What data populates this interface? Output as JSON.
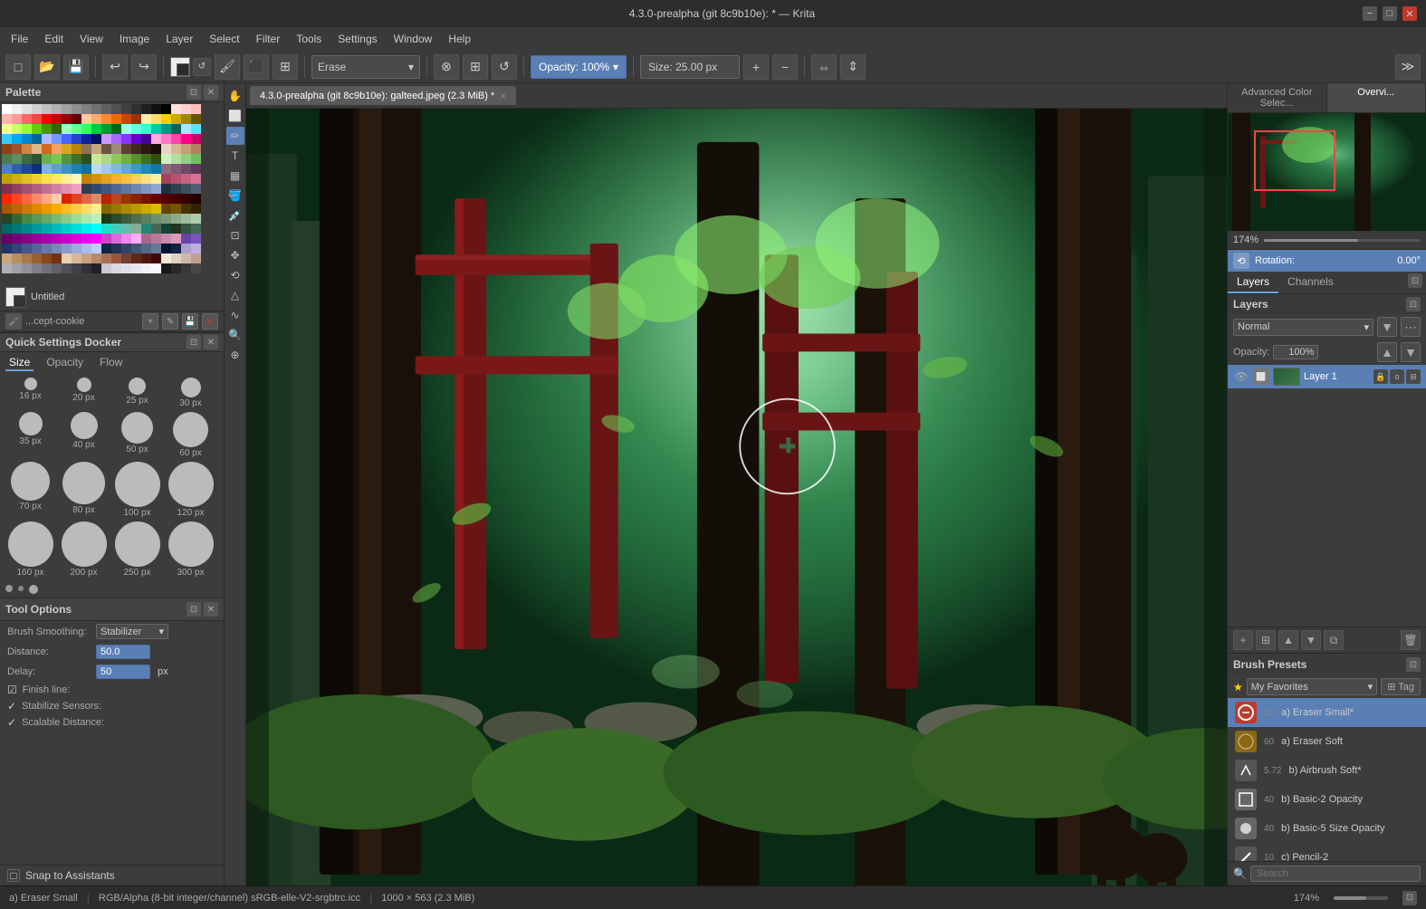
{
  "window": {
    "title": "4.3.0-prealpha (git 8c9b10e):  * — Krita",
    "min_btn": "−",
    "restore_btn": "□",
    "close_btn": "✕"
  },
  "menu": {
    "items": [
      "File",
      "Edit",
      "View",
      "Image",
      "Layer",
      "Select",
      "Filter",
      "Tools",
      "Settings",
      "Window",
      "Help"
    ]
  },
  "toolbar": {
    "erase_label": "Erase",
    "opacity_label": "Opacity: 100%",
    "size_label": "Size: 25.00 px"
  },
  "canvas_tab": {
    "label": "4.3.0-prealpha (git 8c9b10e): galteed.jpeg (2.3 MiB) *",
    "close": "×"
  },
  "palette": {
    "title": "Palette"
  },
  "color_indicator": {
    "label": "Untitled"
  },
  "brush_set": {
    "name": "...cept-cookie"
  },
  "quick_settings": {
    "title": "Quick Settings Docker",
    "tabs": [
      "Size",
      "Opacity",
      "Flow"
    ],
    "active_tab": "Size",
    "brushes": [
      {
        "size": 16,
        "px_label": "16 px",
        "r": 7
      },
      {
        "size": 20,
        "px_label": "20 px",
        "r": 8
      },
      {
        "size": 25,
        "px_label": "25 px",
        "r": 10
      },
      {
        "size": 30,
        "px_label": "30 px",
        "r": 11
      },
      {
        "size": 35,
        "px_label": "35 px",
        "r": 13
      },
      {
        "size": 40,
        "px_label": "40 px",
        "r": 15
      },
      {
        "size": 50,
        "px_label": "50 px",
        "r": 18
      },
      {
        "size": 60,
        "px_label": "60 px",
        "r": 20
      },
      {
        "size": 70,
        "px_label": "70 px",
        "r": 22
      },
      {
        "size": 80,
        "px_label": "80 px",
        "r": 25
      },
      {
        "size": 100,
        "px_label": "100 px",
        "r": 28
      },
      {
        "size": 120,
        "px_label": "120 px",
        "r": 31
      },
      {
        "size": 160,
        "px_label": "160 px",
        "r": 36
      },
      {
        "size": 200,
        "px_label": "200 px",
        "r": 40
      },
      {
        "size": 250,
        "px_label": "250 px",
        "r": 44
      },
      {
        "size": 300,
        "px_label": "300 px",
        "r": 48
      }
    ]
  },
  "tool_options": {
    "title": "Tool Options",
    "brush_smoothing_label": "Brush Smoothing:",
    "brush_smoothing_value": "Stabilizer",
    "distance_label": "Distance:",
    "distance_value": "50.0",
    "delay_label": "Delay:",
    "delay_value": "50",
    "delay_unit": "px",
    "finish_line_label": "Finish line:",
    "stabilize_sensors_label": "Stabilize Sensors:",
    "scalable_distance_label": "Scalable Distance:"
  },
  "snap": {
    "label": "Snap to Assistants"
  },
  "overview": {
    "active_tab": "Overview",
    "tabs": [
      "Advanced Color Selec...",
      "Overvi..."
    ],
    "zoom_pct": "174%",
    "rotation_label": "Rotation:",
    "rotation_value": "0.00°"
  },
  "layers": {
    "title": "Layers",
    "tabs": [
      "Layers",
      "Channels"
    ],
    "blend_mode": "Normal",
    "opacity_label": "Opacity:",
    "opacity_value": "100%",
    "items": [
      {
        "name": "Layer 1",
        "visible": true
      }
    ]
  },
  "brush_presets": {
    "title": "Brush Presets",
    "filter": "★ My Favorites",
    "tag_btn": "⊞ Tag",
    "items": [
      {
        "num": "25",
        "name": "a) Eraser Small*",
        "color": "#c0392b",
        "active": true
      },
      {
        "num": "60",
        "name": "a) Eraser Soft",
        "color": "#8B6914"
      },
      {
        "num": "5.72",
        "name": "b) Airbrush Soft*",
        "color": "#555"
      },
      {
        "num": "40",
        "name": "b) Basic-2 Opacity",
        "color": "#555"
      },
      {
        "num": "40",
        "name": "b) Basic-5 Size Opacity",
        "color": "#555"
      },
      {
        "num": "10",
        "name": "c) Pencil-2",
        "color": "#555"
      }
    ],
    "search_placeholder": "Search"
  },
  "status_bar": {
    "brush_name": "a) Eraser Small",
    "color_profile": "RGB/Alpha (8-bit integer/channel)  sRGB-elle-V2-srgbtrc.icc",
    "dimensions": "1000 × 563 (2.3 MiB)",
    "zoom": "174%"
  }
}
